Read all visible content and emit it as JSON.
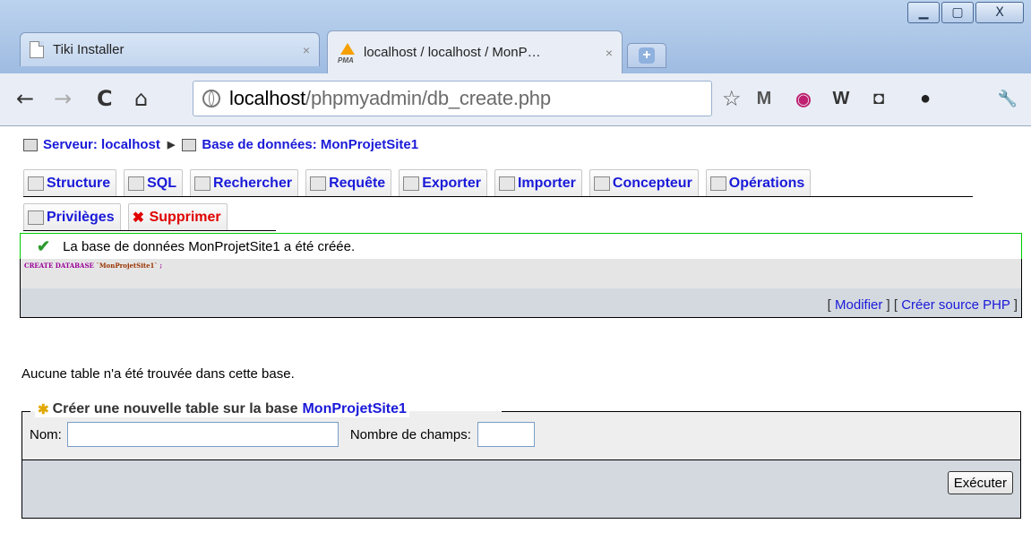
{
  "window": {
    "minimize_icon": "minimize-icon",
    "maximize_icon": "maximize-icon",
    "close_icon": "close-icon",
    "minimize_glyph": "▁",
    "maximize_glyph": "▢",
    "close_glyph": "X"
  },
  "tabs": [
    {
      "title": "Tiki Installer",
      "close": "×"
    },
    {
      "title": "localhost / localhost / MonP…",
      "close": "×"
    }
  ],
  "newtab_glyph": "+",
  "toolbar": {
    "back": "←",
    "forward": "→",
    "reload": "C",
    "home": "⌂",
    "url_host": "localhost",
    "url_path": "/phpmyadmin/db_create.php",
    "star": "☆",
    "extensions": [
      "M",
      "◉",
      "W",
      "◘",
      "●",
      "🔧"
    ]
  },
  "breadcrumb": {
    "server": "Serveur: localhost",
    "database": "Base de données: MonProjetSite1"
  },
  "pma_tabs_row1": [
    "Structure",
    "SQL",
    "Rechercher",
    "Requête",
    "Exporter",
    "Importer",
    "Concepteur",
    "Opérations"
  ],
  "pma_tabs_row2": [
    "Privilèges",
    "Supprimer"
  ],
  "success_message": "La base de données MonProjetSite1 a été créée.",
  "sql_query": {
    "keyword": "CREATE DATABASE",
    "identifier": "`MonProjetSite1`",
    "terminator": " ;"
  },
  "sql_links": {
    "open1": "[ ",
    "modify": "Modifier",
    "sep": " ] [ ",
    "php_source": "Créer source PHP",
    "close": " ]"
  },
  "no_tables_message": "Aucune table n'a été trouvée dans cette base.",
  "create_table": {
    "legend": "Créer une nouvelle table sur la base",
    "db_name": "MonProjetSite1",
    "name_label": "Nom:",
    "name_value": "",
    "fields_label": "Nombre de champs:",
    "fields_value": "",
    "execute": "Exécuter"
  }
}
